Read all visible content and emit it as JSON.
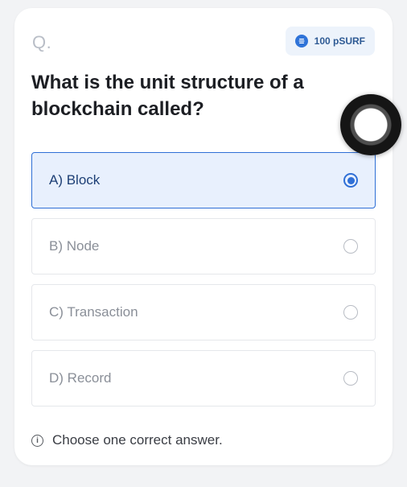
{
  "quiz": {
    "question_marker": "Q.",
    "reward": {
      "icon": "coin-icon",
      "text": "100 pSURF"
    },
    "question": "What is the unit structure of a blockchain called?",
    "options": [
      {
        "label": "A) Block",
        "selected": true
      },
      {
        "label": "B) Node",
        "selected": false
      },
      {
        "label": "C) Transaction",
        "selected": false
      },
      {
        "label": "D) Record",
        "selected": false
      }
    ],
    "hint": "Choose one correct answer."
  },
  "colors": {
    "accent": "#2f6fd6",
    "selected_background": "#e8f0fd",
    "muted_text": "#8a8f98"
  },
  "overlay": {
    "icon": "assistive-touch-icon"
  }
}
